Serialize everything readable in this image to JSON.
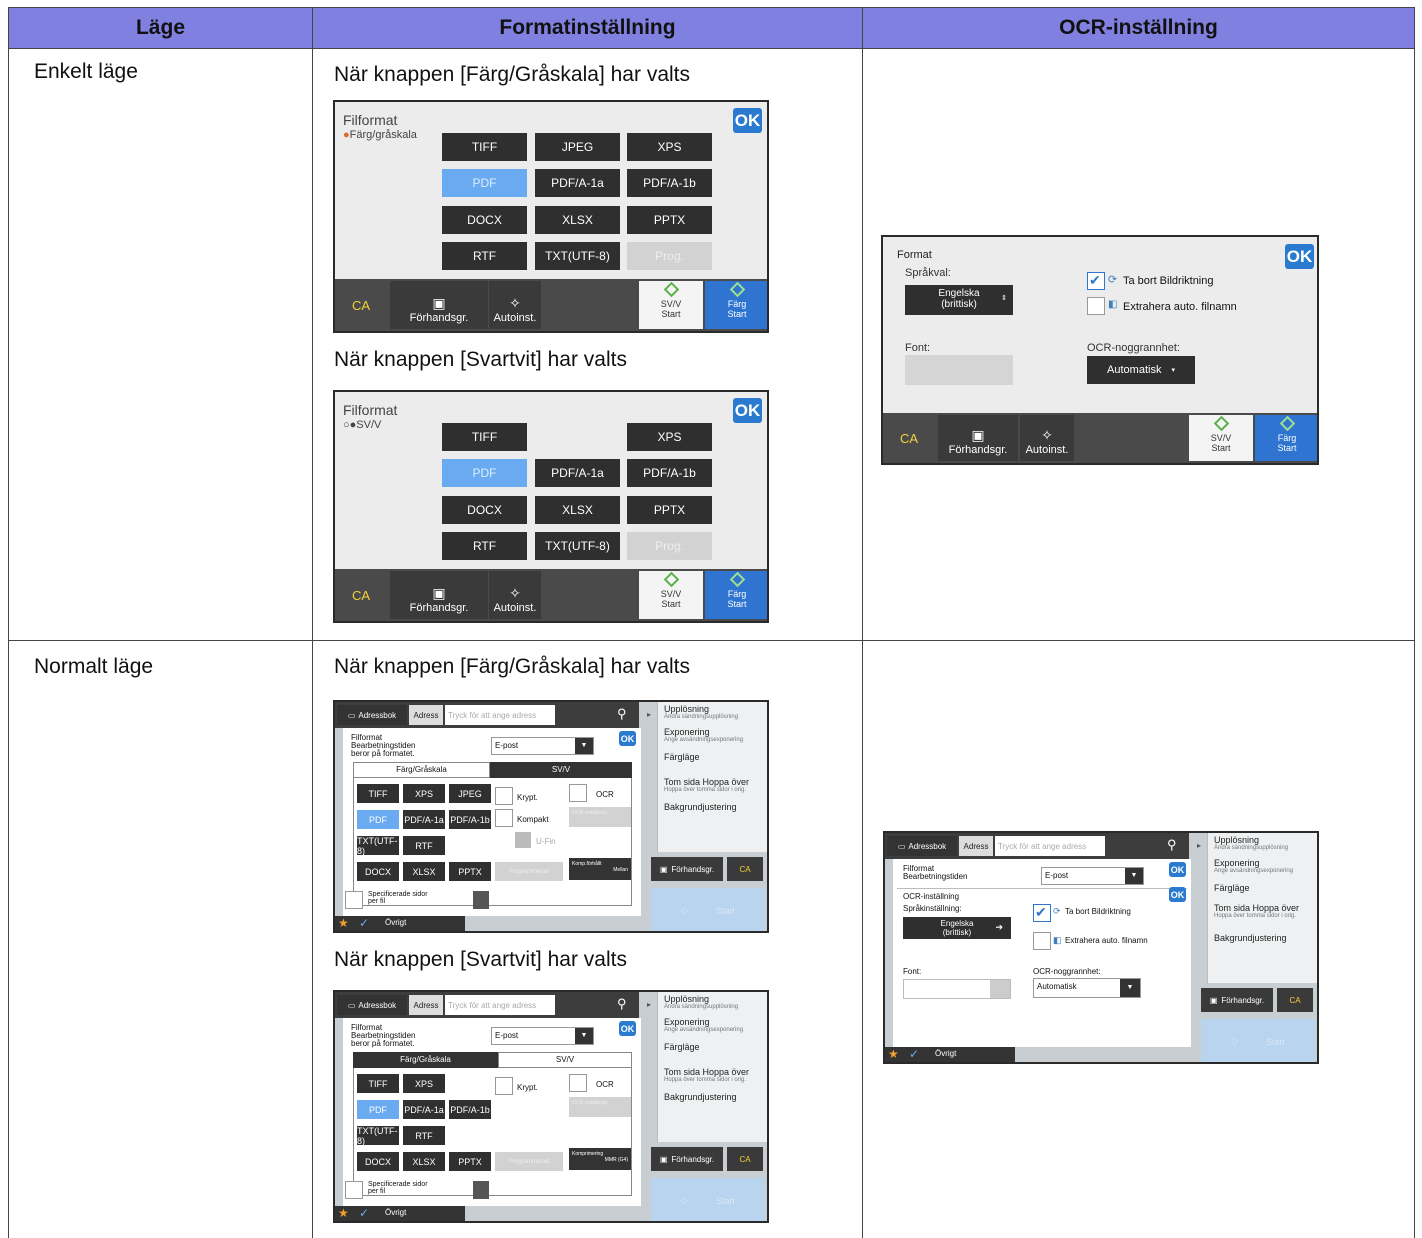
{
  "headers": {
    "col1": "Läge",
    "col2": "Formatinställning",
    "col3": "OCR-inställning"
  },
  "rows": [
    {
      "mode": "Enkelt läge"
    },
    {
      "mode": "Normalt läge"
    }
  ],
  "captions": {
    "color": "När knappen [Färg/Gråskala] har valts",
    "bw": "När knappen [Svartvit] har valts"
  },
  "easy_color": {
    "title": "Filformat",
    "sub": "Färg/gråskala",
    "ok": "OK",
    "buttons": [
      "TIFF",
      "JPEG",
      "XPS",
      "PDF",
      "PDF/A-1a",
      "PDF/A-1b",
      "DOCX",
      "XLSX",
      "PPTX",
      "RTF",
      "TXT(UTF-8)",
      "Prog."
    ]
  },
  "easy_bw": {
    "title": "Filformat",
    "sub": "SV/V",
    "ok": "OK",
    "buttons": [
      "TIFF",
      "XPS",
      "PDF",
      "PDF/A-1a",
      "PDF/A-1b",
      "DOCX",
      "XLSX",
      "PPTX",
      "RTF",
      "TXT(UTF-8)",
      "Prog."
    ]
  },
  "bottom": {
    "ca": "CA",
    "preview": "Förhandsgr.",
    "auto": "Autoinst.",
    "bw_start": "SV/V",
    "start": "Start",
    "color_start": "Färg"
  },
  "easy_ocr": {
    "title": "Format",
    "ok": "OK",
    "lang_label": "Språkval:",
    "lang_value1": "Engelska",
    "lang_value2": "(brittisk)",
    "remove": "Ta bort Bildriktning",
    "extract": "Extrahera auto. filnamn",
    "font_label": "Font:",
    "acc_label": "OCR-noggrannhet:",
    "acc_value": "Automatisk"
  },
  "normal": {
    "addrbook": "Adressbok",
    "addr": "Adress",
    "placeholder": "Tryck för att ange adress",
    "title": "Filformat",
    "proc1": "Bearbetningstiden",
    "proc2": "beror på formatet.",
    "epost": "E-post",
    "ok": "OK",
    "tab_color": "Färg/Gråskala",
    "tab_bw": "SV/V",
    "encrypt": "Krypt.",
    "ocr": "OCR",
    "compact": "Kompakt",
    "ufin": "U-Fin",
    "ocr_set": "OCR-inställning",
    "programmed": "Programmerad",
    "compress_c1": "Komp.förhållt",
    "compress_c2": "Mellan",
    "compress_b1": "Komprimering",
    "compress_b2": "MMR (G4)",
    "spec1": "Specificerade sidor",
    "spec2": "per fil",
    "other": "Övrigt",
    "preview": "Förhandsgr.",
    "ca": "CA",
    "start": "Start",
    "color_buttons": [
      "TIFF",
      "XPS",
      "JPEG",
      "PDF",
      "PDF/A-1a",
      "PDF/A-1b",
      "TXT(UTF-8)",
      "RTF",
      "DOCX",
      "XLSX",
      "PPTX"
    ],
    "bw_buttons": [
      "TIFF",
      "XPS",
      "PDF",
      "PDF/A-1a",
      "PDF/A-1b",
      "TXT(UTF-8)",
      "RTF",
      "DOCX",
      "XLSX",
      "PPTX"
    ],
    "menu": [
      {
        "t": "Upplösning",
        "s": "Ändra sändningsupplösning"
      },
      {
        "t": "Exponering",
        "s": "Ange avsändningsexponering"
      },
      {
        "t": "Färgläge",
        "s": ""
      },
      {
        "t": "Tom sida Hoppa över",
        "s": "Hoppa över tomma sidor i orig."
      },
      {
        "t": "Bakgrundjustering",
        "s": ""
      }
    ]
  },
  "normal_ocr": {
    "title": "Filformat",
    "proc": "Bearbetningstiden",
    "epost": "E-post",
    "ok": "OK",
    "ocr_title": "OCR-inställning",
    "lang_label": "Språkinställning:",
    "lang_value1": "Engelska",
    "lang_value2": "(brittisk)",
    "remove": "Ta bort Bildriktning",
    "extract": "Extrahera auto. filnamn",
    "font_label": "Font:",
    "acc_label": "OCR-noggrannhet:",
    "acc_value": "Automatisk"
  }
}
